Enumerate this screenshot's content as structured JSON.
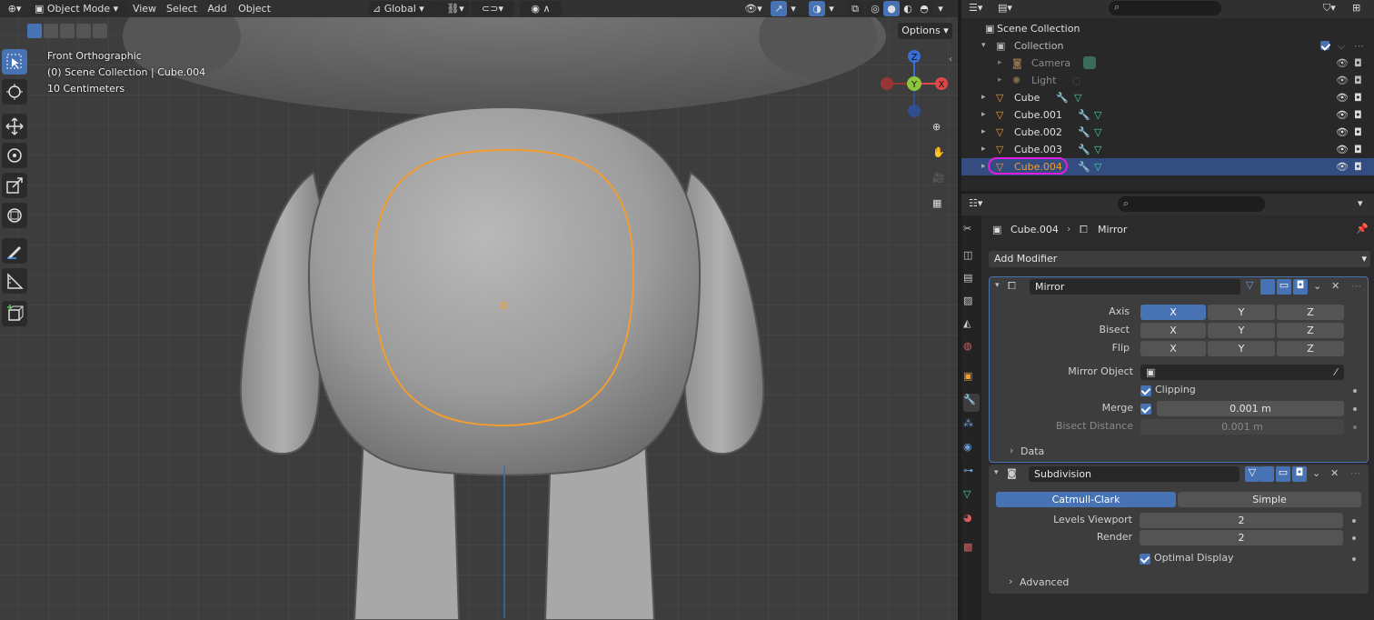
{
  "viewport": {
    "mode_label": "Object Mode",
    "menus": [
      "View",
      "Select",
      "Add",
      "Object"
    ],
    "orientation_label": "Global",
    "options_label": "Options",
    "overlay_lines": [
      "Front Orthographic",
      "(0) Scene Collection | Cube.004",
      "10 Centimeters"
    ],
    "gizmo_labels": {
      "z": "Z",
      "y": "Y",
      "x": "X"
    }
  },
  "outliner": {
    "rows": [
      {
        "name": "Scene Collection"
      },
      {
        "name": "Collection"
      },
      {
        "name": "Camera"
      },
      {
        "name": "Light"
      },
      {
        "name": "Cube"
      },
      {
        "name": "Cube.001"
      },
      {
        "name": "Cube.002"
      },
      {
        "name": "Cube.003"
      },
      {
        "name": "Cube.004"
      }
    ]
  },
  "properties": {
    "breadcrumb_object": "Cube.004",
    "breadcrumb_modifier": "Mirror",
    "add_modifier_label": "Add Modifier",
    "mirror": {
      "name": "Mirror",
      "axis_label": "Axis",
      "bisect_label": "Bisect",
      "flip_label": "Flip",
      "x": "X",
      "y": "Y",
      "z": "Z",
      "mirror_object_label": "Mirror Object",
      "clipping_label": "Clipping",
      "merge_label": "Merge",
      "merge_value": "0.001 m",
      "bisect_distance_label": "Bisect Distance",
      "bisect_distance_value": "0.001 m",
      "data_label": "Data"
    },
    "subdivision": {
      "name": "Subdivision",
      "catmull_label": "Catmull-Clark",
      "simple_label": "Simple",
      "levels_viewport_label": "Levels Viewport",
      "levels_viewport_value": "2",
      "render_label": "Render",
      "render_value": "2",
      "optimal_display_label": "Optimal Display",
      "advanced_label": "Advanced"
    }
  },
  "colors": {
    "accent": "#4772b3",
    "selection_outline": "#f39c30",
    "highlight_ring": "#e01ee0"
  }
}
